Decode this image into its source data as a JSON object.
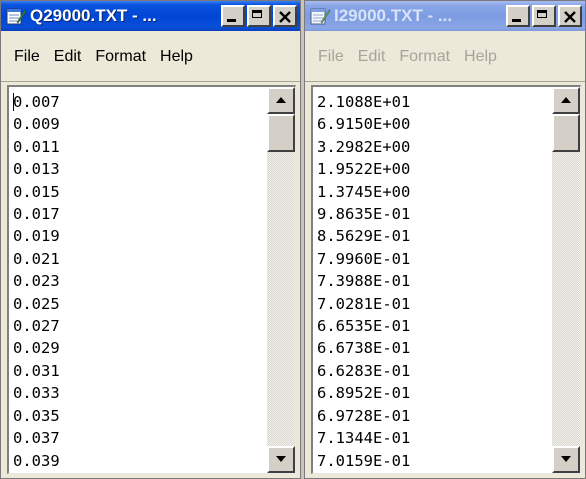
{
  "left_window": {
    "title": "Q29000.TXT - ...",
    "menu": [
      "File",
      "Edit",
      "Format",
      "Help"
    ],
    "lines": [
      "0.007",
      "0.009",
      "0.011",
      "0.013",
      "0.015",
      "0.017",
      "0.019",
      "0.021",
      "0.023",
      "0.025",
      "0.027",
      "0.029",
      "0.031",
      "0.033",
      "0.035",
      "0.037",
      "0.039"
    ]
  },
  "right_window": {
    "title": "I29000.TXT - ...",
    "menu": [
      "File",
      "Edit",
      "Format",
      "Help"
    ],
    "lines": [
      "2.1088E+01",
      "6.9150E+00",
      "3.2982E+00",
      "1.9522E+00",
      "1.3745E+00",
      "9.8635E-01",
      "8.5629E-01",
      "7.9960E-01",
      "7.3988E-01",
      "7.0281E-01",
      "6.6535E-01",
      "6.6738E-01",
      "6.6283E-01",
      "6.8952E-01",
      "6.9728E-01",
      "7.1344E-01",
      "7.0159E-01"
    ]
  },
  "icons": {
    "app": "notepad-icon",
    "minimize": "minimize-icon",
    "maximize": "maximize-icon",
    "close": "close-icon",
    "scroll_up": "arrow-up-icon",
    "scroll_down": "arrow-down-icon"
  },
  "colors": {
    "active_titlebar": "#0046d5",
    "inactive_titlebar": "#7d9ce3",
    "window_face": "#ece9d8",
    "editor_bg": "#ffffff"
  }
}
